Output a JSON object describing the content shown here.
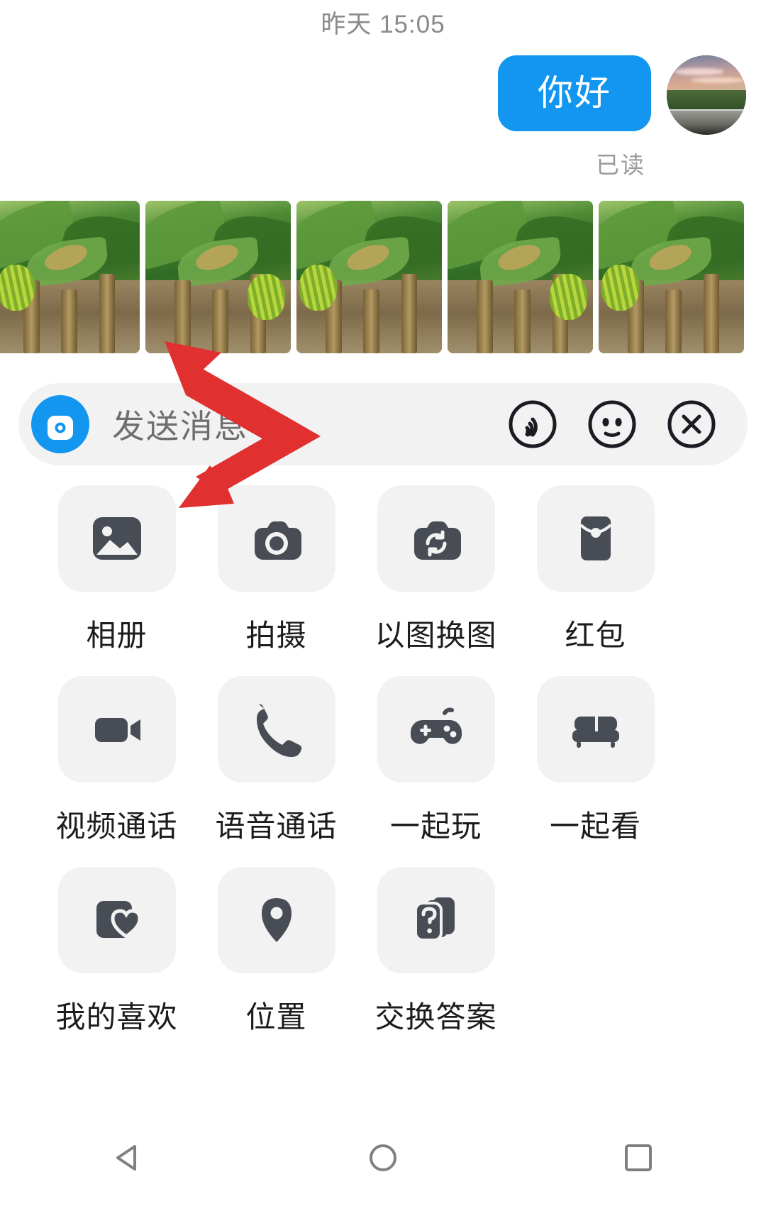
{
  "conversation": {
    "timestamp": "昨天 15:05",
    "message": {
      "text": "你好",
      "bubble_color": "#1296f0",
      "read_receipt": "已读"
    },
    "avatar": "user-avatar-sunset-road"
  },
  "photo_strip": {
    "name": "recent-photos-strip",
    "items": [
      {
        "alt": "banana-plantation-1"
      },
      {
        "alt": "banana-plantation-2"
      },
      {
        "alt": "banana-plantation-3"
      },
      {
        "alt": "banana-plantation-4"
      },
      {
        "alt": "banana-plantation-5"
      }
    ]
  },
  "input_bar": {
    "placeholder": "发送消息",
    "voice_icon": "voice-record-icon",
    "accent_color": "#1296f0",
    "background": "#f2f2f2",
    "actions": [
      {
        "icon": "sound-wave-circle-icon",
        "name": "voice-message-button"
      },
      {
        "icon": "emoji-face-circle-icon",
        "name": "emoji-button"
      },
      {
        "icon": "close-circle-icon",
        "name": "close-panel-button"
      }
    ]
  },
  "app_panel": {
    "rows": [
      [
        {
          "label": "相册",
          "icon": "photo-gallery-icon",
          "name": "album"
        },
        {
          "label": "拍摄",
          "icon": "camera-icon",
          "name": "capture"
        },
        {
          "label": "以图换图",
          "icon": "camera-refresh-icon",
          "name": "image-swap"
        },
        {
          "label": "红包",
          "icon": "red-packet-icon",
          "name": "red-packet"
        }
      ],
      [
        {
          "label": "视频通话",
          "icon": "video-camera-icon",
          "name": "video-call"
        },
        {
          "label": "语音通话",
          "icon": "phone-icon",
          "name": "voice-call"
        },
        {
          "label": "一起玩",
          "icon": "gamepad-icon",
          "name": "play-together"
        },
        {
          "label": "一起看",
          "icon": "sofa-icon",
          "name": "watch-together"
        }
      ],
      [
        {
          "label": "我的喜欢",
          "icon": "heart-card-icon",
          "name": "my-favorites"
        },
        {
          "label": "位置",
          "icon": "location-pin-icon",
          "name": "location"
        },
        {
          "label": "交换答案",
          "icon": "question-cards-icon",
          "name": "swap-answers"
        }
      ]
    ]
  },
  "annotation": {
    "name": "red-double-arrow",
    "color": "#e03030",
    "points_to": [
      "recent-photos-strip",
      "album"
    ]
  },
  "navbar": {
    "items": [
      {
        "icon": "back-triangle-icon",
        "name": "nav-back"
      },
      {
        "icon": "home-circle-icon",
        "name": "nav-home"
      },
      {
        "icon": "recents-square-icon",
        "name": "nav-recents"
      }
    ],
    "color": "#808080"
  }
}
